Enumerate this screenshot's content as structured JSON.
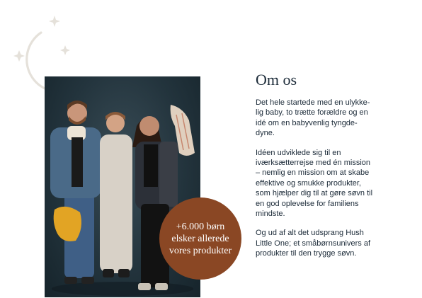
{
  "section": {
    "title": "Om os",
    "paragraphs": [
      [
        "Det hele startede med en ulykke-",
        "lig baby, to trætte forældre og en",
        "idé om en babyvenlig tyngde-",
        "dyne."
      ],
      [
        "Idéen udviklede sig til en",
        "iværksætterrejse med én mission",
        "– nemlig en mission om at skabe",
        "effektive og smukke produkter,",
        "som hjælper dig til at gøre søvn til",
        "en god oplevelse for familiens",
        "mindste."
      ],
      [
        "Og ud af alt det udsprang Hush",
        "Little One; et småbørnsunivers af",
        "produkter til den trygge søvn."
      ]
    ]
  },
  "badge": {
    "lines": [
      "+6.000 børn",
      "elsker allerede",
      "vores produkter"
    ]
  },
  "icons": {
    "decoration": "moon-and-stars-icon"
  },
  "colors": {
    "badge": "#8a4724",
    "text": "#1b2a38",
    "decoration": "#e5e1da"
  }
}
